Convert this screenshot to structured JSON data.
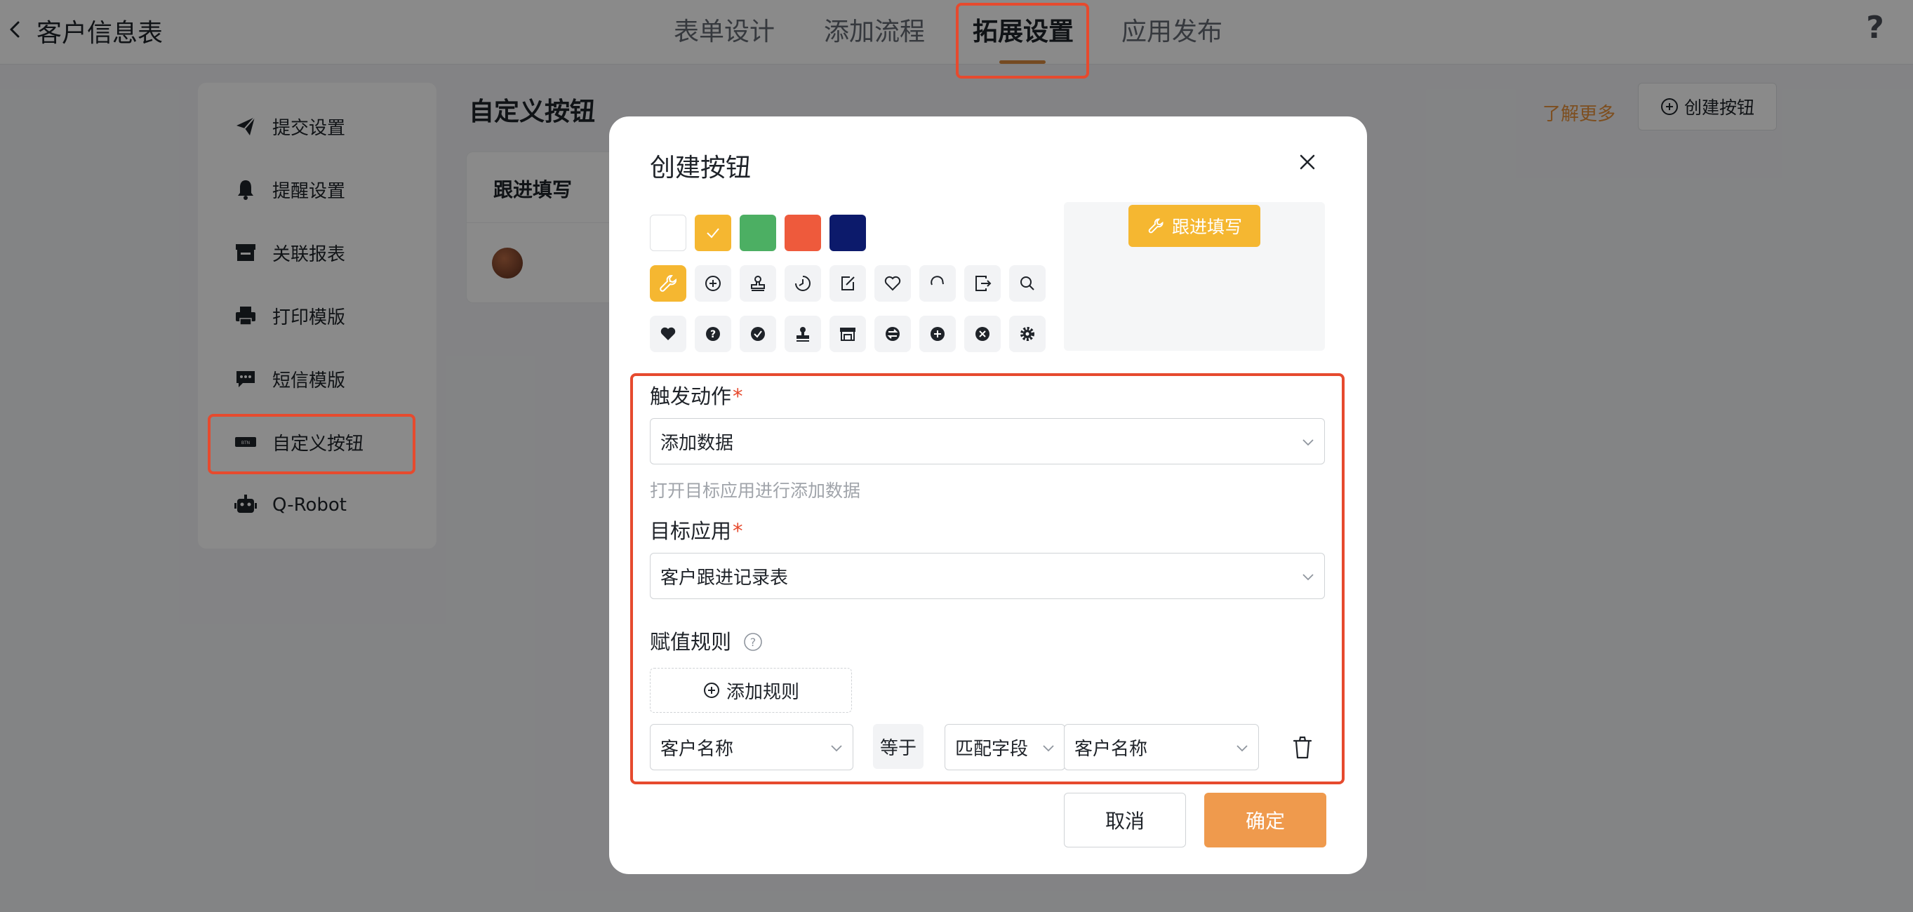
{
  "header": {
    "title": "客户信息表",
    "tabs": [
      {
        "label": "表单设计"
      },
      {
        "label": "添加流程"
      },
      {
        "label": "拓展设置"
      },
      {
        "label": "应用发布"
      }
    ],
    "active_tab": "拓展设置"
  },
  "sidebar": {
    "items": [
      {
        "label": "提交设置",
        "icon": "send-icon"
      },
      {
        "label": "提醒设置",
        "icon": "bell-icon"
      },
      {
        "label": "关联报表",
        "icon": "report-icon"
      },
      {
        "label": "打印模版",
        "icon": "printer-icon"
      },
      {
        "label": "短信模版",
        "icon": "message-icon"
      },
      {
        "label": "自定义按钮",
        "icon": "button-icon"
      },
      {
        "label": "Q-Robot",
        "icon": "robot-icon"
      }
    ],
    "active_item": "自定义按钮"
  },
  "main": {
    "title": "自定义按钮",
    "learn_more": "了解更多",
    "create_button_label": "创建按钮",
    "card_title": "跟进填写"
  },
  "dialog": {
    "title": "创建按钮",
    "colors": [
      "#ffffff",
      "#f5b731",
      "#4caf63",
      "#ee5a3c",
      "#0c1a6b"
    ],
    "selected_color": "#f5b731",
    "icons_row1": [
      "wrench-icon",
      "plus-circle-icon",
      "stamp-icon",
      "clock-icon",
      "edit-square-icon",
      "heart-icon",
      "refresh-icon",
      "export-icon",
      "search-icon"
    ],
    "icons_row2": [
      "heart-filled-icon",
      "help-filled-icon",
      "check-filled-icon",
      "stamp-filled-icon",
      "shop-icon",
      "swap-filled-icon",
      "plus-filled-icon",
      "close-filled-icon",
      "settings-filled-icon"
    ],
    "selected_icon": "wrench-icon",
    "preview_label": "跟进填写",
    "trigger": {
      "label": "触发动作",
      "required_mark": "*",
      "value": "添加数据",
      "hint": "打开目标应用进行添加数据"
    },
    "target": {
      "label": "目标应用",
      "required_mark": "*",
      "value": "客户跟进记录表"
    },
    "rules": {
      "label": "赋值规则",
      "add_label": "添加规则",
      "row": {
        "field": "客户名称",
        "operator": "等于",
        "match_type": "匹配字段",
        "match_value": "客户名称"
      }
    },
    "cancel_label": "取消",
    "ok_label": "确定"
  },
  "colors": {
    "accent": "#ef9a4d",
    "highlight": "#e64a2e",
    "brand_yellow": "#f5b731"
  }
}
